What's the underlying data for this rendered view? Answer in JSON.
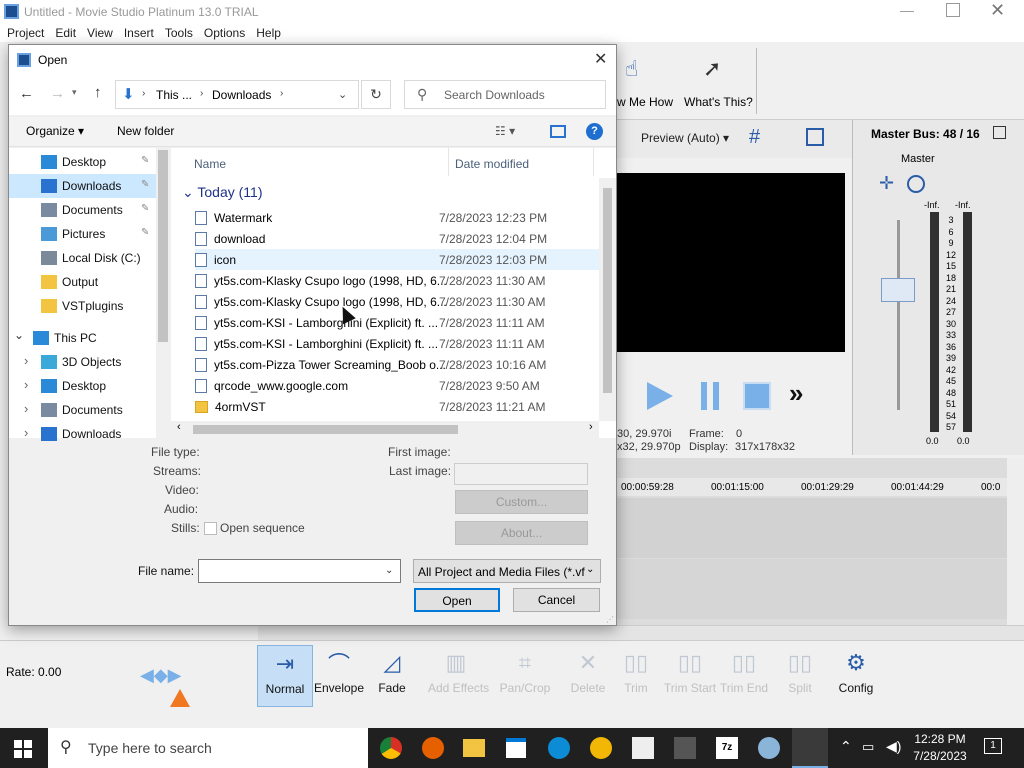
{
  "app": {
    "title": "Untitled - Movie Studio Platinum 13.0 TRIAL",
    "menu": [
      "Project",
      "Edit",
      "View",
      "Insert",
      "Tools",
      "Options",
      "Help"
    ],
    "toolbar": {
      "show_me_how": "w Me How",
      "whats_this": "What's This?"
    },
    "preview": {
      "mode": "Preview (Auto)",
      "frame_label": "Frame:",
      "frame_value": "0",
      "display_label": "Display:",
      "display_value": "317x178x32",
      "left_info_1": "30, 29.970i",
      "left_info_2": "x32, 29.970p"
    },
    "master_bus": {
      "title": "Master Bus: 48 / 16",
      "master_label": "Master",
      "inf_left": "-Inf.",
      "inf_right": "-Inf.",
      "scale": [
        "3",
        "6",
        "9",
        "12",
        "15",
        "18",
        "21",
        "24",
        "27",
        "30",
        "33",
        "36",
        "39",
        "42",
        "45",
        "48",
        "51",
        "54",
        "57"
      ],
      "bottom_left": "0.0",
      "bottom_right": "0.0"
    },
    "timeline": {
      "ruler": [
        "00:00:59:28",
        "00:01:15:00",
        "00:01:29:29",
        "00:01:44:29",
        "00:0"
      ]
    },
    "rate": "Rate: 0.00",
    "bottom_tools": [
      {
        "label": "Normal",
        "icon": "normal-tool-icon"
      },
      {
        "label": "Envelope",
        "icon": "envelope-tool-icon"
      },
      {
        "label": "Fade",
        "icon": "fade-tool-icon"
      },
      {
        "label": "Add Effects",
        "icon": "effects-icon"
      },
      {
        "label": "Pan/Crop",
        "icon": "crop-icon"
      },
      {
        "label": "Delete",
        "icon": "delete-icon"
      },
      {
        "label": "Trim",
        "icon": "trim-icon"
      },
      {
        "label": "Trim Start",
        "icon": "trim-start-icon"
      },
      {
        "label": "Trim End",
        "icon": "trim-end-icon"
      },
      {
        "label": "Split",
        "icon": "split-icon"
      },
      {
        "label": "Config",
        "icon": "gear-icon"
      }
    ]
  },
  "dialog": {
    "title": "Open",
    "breadcrumb": [
      "This ...",
      "Downloads"
    ],
    "search_placeholder": "Search Downloads",
    "organize": "Organize",
    "new_folder": "New folder",
    "nav": [
      {
        "label": "Desktop",
        "icon": "desktop-icon",
        "pinned": true
      },
      {
        "label": "Downloads",
        "icon": "downloads-icon",
        "pinned": true,
        "selected": true
      },
      {
        "label": "Documents",
        "icon": "documents-icon",
        "pinned": true
      },
      {
        "label": "Pictures",
        "icon": "pictures-icon",
        "pinned": true
      },
      {
        "label": "Local Disk (C:)",
        "icon": "disk-icon"
      },
      {
        "label": "Output",
        "icon": "folder-icon"
      },
      {
        "label": "VSTplugins",
        "icon": "folder-icon"
      },
      {
        "label": "This PC",
        "icon": "pc-icon",
        "section": true
      },
      {
        "label": "3D Objects",
        "icon": "3d-icon"
      },
      {
        "label": "Desktop",
        "icon": "desktop-icon"
      },
      {
        "label": "Documents",
        "icon": "documents-icon"
      },
      {
        "label": "Downloads",
        "icon": "downloads-icon"
      }
    ],
    "columns": {
      "name": "Name",
      "date": "Date modified"
    },
    "group": "Today (11)",
    "files": [
      {
        "name": "Watermark",
        "date": "7/28/2023 12:23 PM",
        "type": "file"
      },
      {
        "name": "download",
        "date": "7/28/2023 12:04 PM",
        "type": "file"
      },
      {
        "name": "icon",
        "date": "7/28/2023 12:03 PM",
        "type": "file",
        "hover": true
      },
      {
        "name": "yt5s.com-Klasky Csupo logo (1998, HD, 6...",
        "date": "7/28/2023 11:30 AM",
        "type": "file"
      },
      {
        "name": "yt5s.com-Klasky Csupo logo (1998, HD, 6...",
        "date": "7/28/2023 11:30 AM",
        "type": "file"
      },
      {
        "name": "yt5s.com-KSI - Lamborghini (Explicit) ft. ...",
        "date": "7/28/2023 11:11 AM",
        "type": "file"
      },
      {
        "name": "yt5s.com-KSI - Lamborghini (Explicit) ft. ...",
        "date": "7/28/2023 11:11 AM",
        "type": "file"
      },
      {
        "name": "yt5s.com-Pizza Tower Screaming_Boob o...",
        "date": "7/28/2023 10:16 AM",
        "type": "file"
      },
      {
        "name": "qrcode_www.google.com",
        "date": "7/28/2023 9:50 AM",
        "type": "file"
      },
      {
        "name": "4ormVST",
        "date": "7/28/2023 11:21 AM",
        "type": "folder"
      }
    ],
    "details": {
      "file_type": "File type:",
      "streams": "Streams:",
      "video": "Video:",
      "audio": "Audio:",
      "stills": "Stills:",
      "open_sequence": "Open sequence",
      "first_image": "First image:",
      "last_image": "Last image:",
      "custom": "Custom...",
      "about": "About..."
    },
    "file_name_label": "File name:",
    "file_name_value": "",
    "filter": "All Project and Media Files (*.vf",
    "open_button": "Open",
    "cancel_button": "Cancel"
  },
  "taskbar": {
    "search_placeholder": "Type here to search",
    "time": "12:28 PM",
    "date": "7/28/2023",
    "notifications": "1"
  }
}
